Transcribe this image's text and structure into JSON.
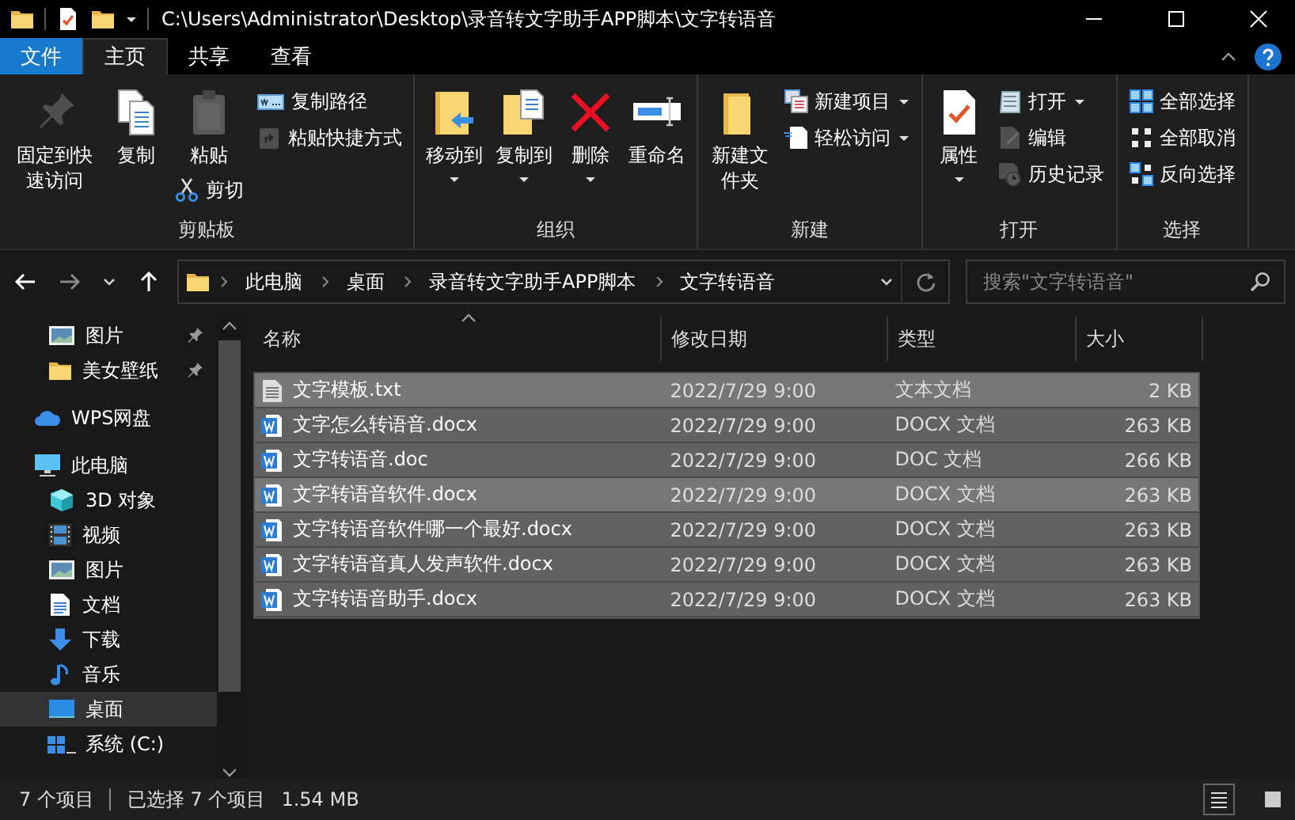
{
  "window": {
    "title": "C:\\Users\\Administrator\\Desktop\\录音转文字助手APP脚本\\文字转语音"
  },
  "ribbon_tabs": [
    {
      "label": "文件",
      "kind": "file",
      "selected": false
    },
    {
      "label": "主页",
      "kind": "tab",
      "selected": true
    },
    {
      "label": "共享",
      "kind": "tab",
      "selected": false
    },
    {
      "label": "查看",
      "kind": "tab",
      "selected": false
    }
  ],
  "ribbon_groups": [
    {
      "label": "剪贴板",
      "columns": [
        {
          "large": [
            {
              "label": "固定到快速访问",
              "kind": "pin",
              "dropdown": false,
              "disabled": true
            }
          ]
        },
        {
          "large": [
            {
              "label": "复制",
              "kind": "copy",
              "dropdown": false,
              "disabled": false
            }
          ]
        },
        {
          "large": [
            {
              "label": "粘贴",
              "kind": "paste",
              "dropdown": false,
              "disabled": true
            }
          ],
          "small": [
            {
              "label": "剪切",
              "kind": "cut",
              "dropdown": false,
              "disabled": false
            }
          ]
        },
        {
          "small": [
            {
              "label": "复制路径",
              "kind": "copypath",
              "dropdown": false,
              "disabled": false
            },
            {
              "label": "粘贴快捷方式",
              "kind": "pasteshortcut",
              "dropdown": false,
              "disabled": true
            }
          ]
        }
      ]
    },
    {
      "label": "组织",
      "columns": [
        {
          "large": [
            {
              "label": "移动到",
              "kind": "moveto",
              "dropdown": true,
              "disabled": false
            }
          ]
        },
        {
          "large": [
            {
              "label": "复制到",
              "kind": "copyto",
              "dropdown": true,
              "disabled": false
            }
          ]
        },
        {
          "large": [
            {
              "label": "删除",
              "kind": "delete",
              "dropdown": true,
              "disabled": false
            }
          ]
        },
        {
          "large": [
            {
              "label": "重命名",
              "kind": "rename",
              "dropdown": false,
              "disabled": false
            }
          ]
        }
      ]
    },
    {
      "label": "新建",
      "columns": [
        {
          "large": [
            {
              "label": "新建文件夹",
              "kind": "newfolder",
              "dropdown": false,
              "disabled": false
            }
          ]
        },
        {
          "small": [
            {
              "label": "新建项目",
              "kind": "newitem",
              "dropdown": true,
              "disabled": false
            },
            {
              "label": "轻松访问",
              "kind": "easyaccess",
              "dropdown": true,
              "disabled": false
            }
          ]
        }
      ]
    },
    {
      "label": "打开",
      "columns": [
        {
          "large": [
            {
              "label": "属性",
              "kind": "properties",
              "dropdown": true,
              "disabled": false
            }
          ]
        },
        {
          "small": [
            {
              "label": "打开",
              "kind": "open",
              "dropdown": true,
              "disabled": false
            },
            {
              "label": "编辑",
              "kind": "edit",
              "dropdown": false,
              "disabled": true
            },
            {
              "label": "历史记录",
              "kind": "history",
              "dropdown": false,
              "disabled": true
            }
          ]
        }
      ]
    },
    {
      "label": "选择",
      "columns": [
        {
          "small": [
            {
              "label": "全部选择",
              "kind": "selectall",
              "dropdown": false,
              "disabled": false
            },
            {
              "label": "全部取消",
              "kind": "selectnone",
              "dropdown": false,
              "disabled": false
            },
            {
              "label": "反向选择",
              "kind": "invert",
              "dropdown": false,
              "disabled": false
            }
          ]
        }
      ]
    }
  ],
  "address": {
    "crumbs": [
      "此电脑",
      "桌面",
      "录音转文字助手APP脚本",
      "文字转语音"
    ]
  },
  "search": {
    "placeholder": "搜索\"文字转语音\""
  },
  "sidebar": {
    "pinned": [
      {
        "label": "图片",
        "kind": "pictures",
        "selected": false
      },
      {
        "label": "美女壁纸",
        "kind": "folder",
        "selected": false
      }
    ],
    "items": [
      {
        "label": "WPS网盘",
        "kind": "cloud",
        "selected": false
      },
      {
        "label": "此电脑",
        "kind": "computer",
        "selected": false,
        "children": [
          {
            "label": "3D 对象",
            "kind": "cube",
            "selected": false
          },
          {
            "label": "视频",
            "kind": "video",
            "selected": false
          },
          {
            "label": "图片",
            "kind": "pictures",
            "selected": false
          },
          {
            "label": "文档",
            "kind": "document",
            "selected": false
          },
          {
            "label": "下载",
            "kind": "download",
            "selected": false
          },
          {
            "label": "音乐",
            "kind": "music",
            "selected": false
          },
          {
            "label": "桌面",
            "kind": "desktop",
            "selected": true
          },
          {
            "label": "系统 (C:)",
            "kind": "drive",
            "selected": false
          }
        ]
      }
    ]
  },
  "table": {
    "columns": [
      "名称",
      "修改日期",
      "类型",
      "大小"
    ],
    "rows": [
      {
        "kind": "txt",
        "name": "文字模板.txt",
        "date": "2022/7/29 9:00",
        "type": "文本文档",
        "size": "2 KB",
        "selected": true,
        "hot": true
      },
      {
        "kind": "word",
        "name": "文字怎么转语音.docx",
        "date": "2022/7/29 9:00",
        "type": "DOCX 文档",
        "size": "263 KB",
        "selected": true,
        "hot": false
      },
      {
        "kind": "word",
        "name": "文字转语音.doc",
        "date": "2022/7/29 9:00",
        "type": "DOC 文档",
        "size": "266 KB",
        "selected": true,
        "hot": false
      },
      {
        "kind": "word",
        "name": "文字转语音软件.docx",
        "date": "2022/7/29 9:00",
        "type": "DOCX 文档",
        "size": "263 KB",
        "selected": true,
        "hot": true
      },
      {
        "kind": "word",
        "name": "文字转语音软件哪一个最好.docx",
        "date": "2022/7/29 9:00",
        "type": "DOCX 文档",
        "size": "263 KB",
        "selected": true,
        "hot": false
      },
      {
        "kind": "word",
        "name": "文字转语音真人发声软件.docx",
        "date": "2022/7/29 9:00",
        "type": "DOCX 文档",
        "size": "263 KB",
        "selected": true,
        "hot": false
      },
      {
        "kind": "word",
        "name": "文字转语音助手.docx",
        "date": "2022/7/29 9:00",
        "type": "DOCX 文档",
        "size": "263 KB",
        "selected": true,
        "hot": false
      }
    ]
  },
  "status_bar": {
    "count": "7 个项目",
    "selection": "已选择 7 个项目",
    "size": "1.54 MB"
  }
}
